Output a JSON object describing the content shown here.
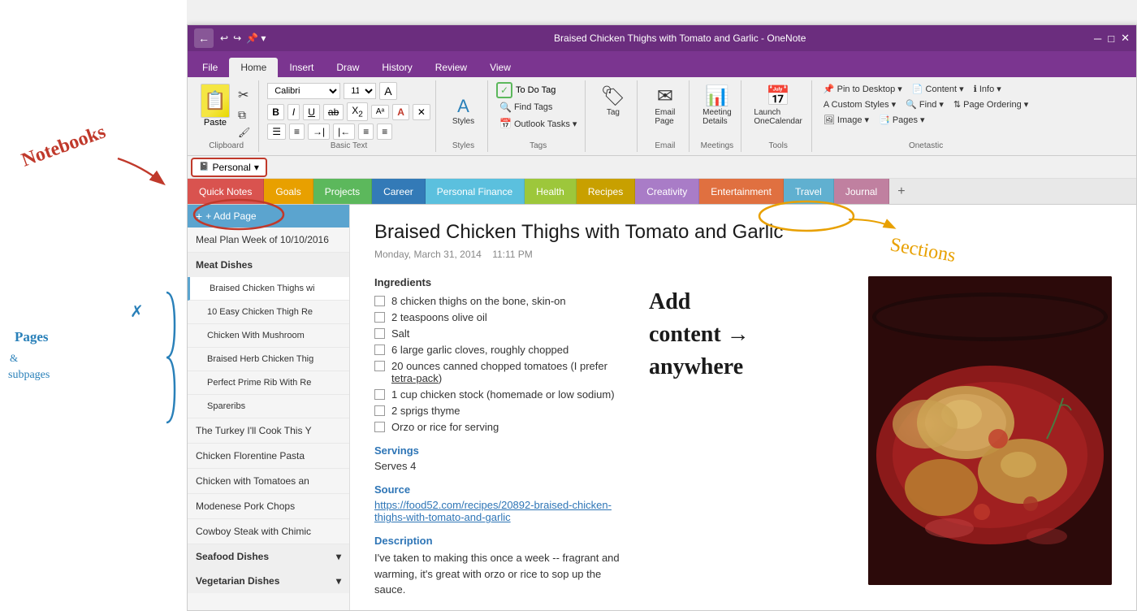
{
  "window": {
    "title": "Braised Chicken Thighs with Tomato and Garlic - OneNote"
  },
  "titlebar": {
    "back_icon": "←",
    "undo_icon": "↩",
    "redo_icon": "↪",
    "pin_icon": "📌"
  },
  "ribbon": {
    "tabs": [
      {
        "label": "File",
        "active": false
      },
      {
        "label": "Home",
        "active": true
      },
      {
        "label": "Insert",
        "active": false
      },
      {
        "label": "Draw",
        "active": false
      },
      {
        "label": "History",
        "active": false
      },
      {
        "label": "Review",
        "active": false
      },
      {
        "label": "View",
        "active": false
      }
    ],
    "groups": {
      "clipboard": {
        "label": "Clipboard",
        "paste_label": "Paste"
      },
      "basic_text": {
        "label": "Basic Text"
      },
      "styles": {
        "label": "Styles"
      },
      "tags": {
        "label": "Tags",
        "todo_tag": "✓ To Do Tag",
        "find_tags": "Find Tags",
        "outlook_tasks": "Outlook Tasks ▾"
      },
      "email": {
        "label": "Email",
        "email_page": "Email Page"
      },
      "meetings": {
        "label": "Meetings",
        "meeting_details": "Meeting Details"
      },
      "tools": {
        "label": "Tools",
        "launch_onecalendar": "Launch OneCalendar"
      },
      "onetastic": {
        "label": "Onetastic",
        "pin_desktop": "Pin to Desktop ▾",
        "custom_styles": "Custom Styles ▾",
        "image": "Image ▾",
        "content": "Content ▾",
        "info": "Info ▾",
        "find": "Find ▾",
        "page_ordering": "Page Ordering ▾",
        "pages": "Pages ▾"
      }
    }
  },
  "sections": [
    {
      "label": "Quick Notes",
      "color": "sec-quicknotes",
      "active": false
    },
    {
      "label": "Goals",
      "color": "sec-goals",
      "active": false
    },
    {
      "label": "Projects",
      "color": "sec-projects",
      "active": false
    },
    {
      "label": "Career",
      "color": "sec-career",
      "active": false
    },
    {
      "label": "Personal Finance",
      "color": "sec-finance",
      "active": false
    },
    {
      "label": "Health",
      "color": "sec-health",
      "active": false
    },
    {
      "label": "Recipes",
      "color": "sec-recipes",
      "active": true
    },
    {
      "label": "Creativity",
      "color": "sec-creativity",
      "active": false
    },
    {
      "label": "Entertainment",
      "color": "sec-entertainment",
      "active": false
    },
    {
      "label": "Travel",
      "color": "sec-travel",
      "active": false
    },
    {
      "label": "Journal",
      "color": "sec-journal",
      "active": false
    }
  ],
  "notebook": {
    "label": "Personal",
    "dropdown_icon": "▾"
  },
  "add_page": "+ Add Page",
  "pages": [
    {
      "label": "Meal Plan Week of 10/10/2016",
      "level": 0,
      "active": false
    },
    {
      "label": "Meat Dishes",
      "level": 0,
      "active": false,
      "is_header": true
    },
    {
      "label": "Braised Chicken Thighs wi",
      "level": 1,
      "active": true
    },
    {
      "label": "10 Easy Chicken Thigh Re",
      "level": 1,
      "active": false
    },
    {
      "label": "Chicken With Mushroom",
      "level": 1,
      "active": false
    },
    {
      "label": "Braised Herb Chicken Thig",
      "level": 1,
      "active": false
    },
    {
      "label": "Perfect Prime Rib With Re",
      "level": 1,
      "active": false
    },
    {
      "label": "Spareribs",
      "level": 1,
      "active": false
    },
    {
      "label": "The Turkey I'll Cook This Y",
      "level": 0,
      "active": false
    },
    {
      "label": "Chicken Florentine Pasta",
      "level": 0,
      "active": false
    },
    {
      "label": "Chicken with Tomatoes an",
      "level": 0,
      "active": false
    },
    {
      "label": "Modenese Pork Chops",
      "level": 0,
      "active": false
    },
    {
      "label": "Cowboy Steak with Chimic",
      "level": 0,
      "active": false
    },
    {
      "label": "Seafood Dishes",
      "level": 0,
      "active": false,
      "is_section": true
    },
    {
      "label": "Vegetarian Dishes",
      "level": 0,
      "active": false,
      "is_section": true
    }
  ],
  "note": {
    "title": "Braised Chicken Thighs with Tomato and Garlic",
    "date": "Monday, March 31, 2014",
    "time": "11:11 PM",
    "ingredients_label": "Ingredients",
    "ingredients": [
      "8 chicken thighs on the bone, skin-on",
      "2 teaspoons olive oil",
      "Salt",
      "6 large garlic cloves, roughly chopped",
      "20 ounces canned chopped tomatoes (I prefer tetra-pack)",
      "1 cup chicken stock (homemade or low sodium)",
      "2 sprigs thyme",
      "Orzo or rice for serving"
    ],
    "servings_label": "Servings",
    "servings_value": "Serves 4",
    "source_label": "Source",
    "source_url": "https://food52.com/recipes/20892-braised-chicken-thighs-with-tomato-and-garlic",
    "description_label": "Description",
    "description_value": "I've taken to making this once a week -- fragrant and warming, it's great with orzo or rice to sop up the sauce."
  },
  "annotations": {
    "notebooks": "Notebooks",
    "pages_subpages": "Pages &\nSubpages",
    "sections": "Sections",
    "add_content": "Add\ncontent →\nanywhere"
  }
}
